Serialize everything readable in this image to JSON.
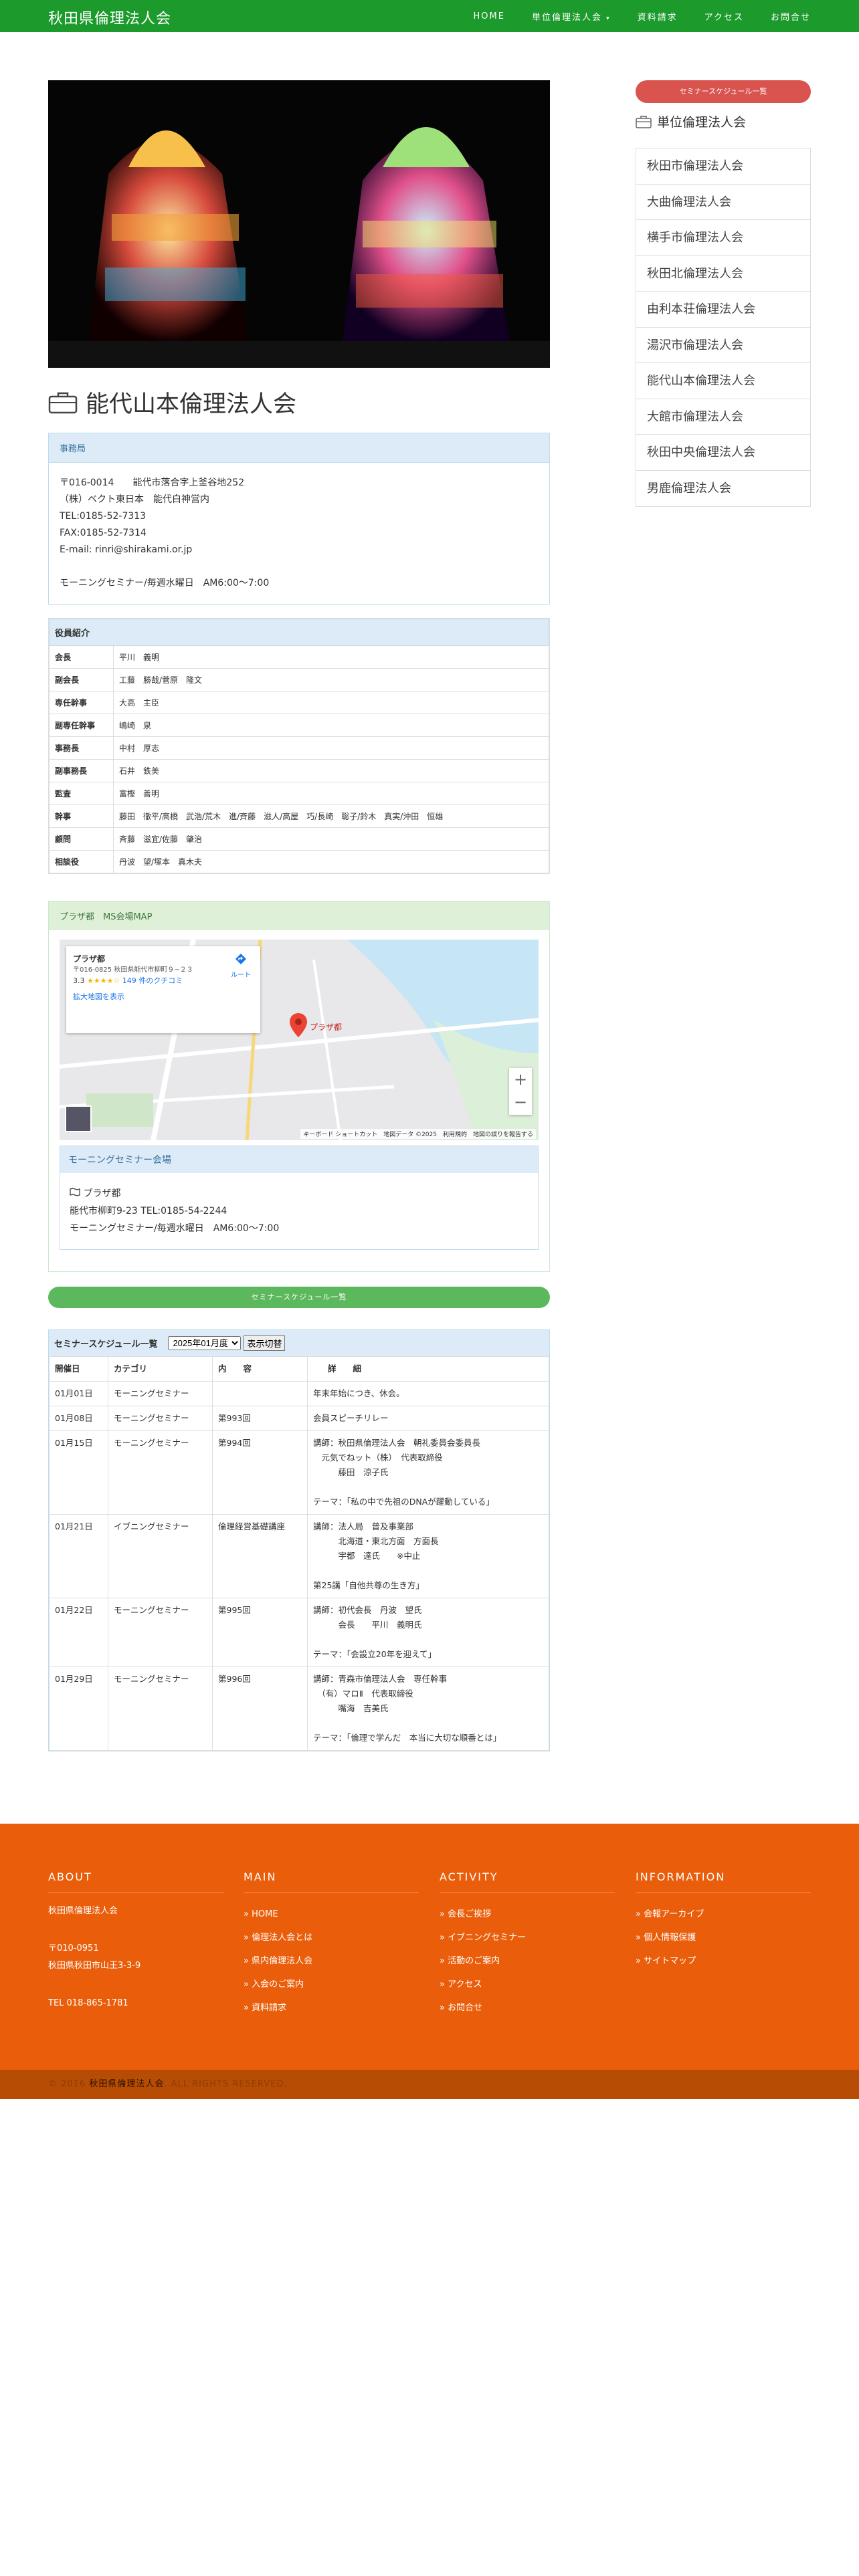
{
  "header": {
    "brand": "秋田県倫理法人会",
    "nav": [
      "HOME",
      "単位倫理法人会 ",
      "資料請求",
      "アクセス",
      "お問合せ"
    ]
  },
  "page_title": "能代山本倫理法人会",
  "office": {
    "heading": "事務局",
    "lines": [
      "〒016-0014　　能代市落合字上釜谷地252",
      "（株）ベクト東日本　能代白神営内",
      "TEL:0185-52-7313",
      "FAX:0185-52-7314",
      "E-mail: rinri@shirakami.or.jp",
      "",
      "モーニングセミナー/毎週水曜日　AM6:00〜7:00"
    ]
  },
  "officers": {
    "heading": "役員紹介",
    "rows": [
      {
        "k": "会長",
        "v": "平川　義明"
      },
      {
        "k": "副会長",
        "v": "工藤　勝哉/菅原　隆文"
      },
      {
        "k": "専任幹事",
        "v": "大高　主臣"
      },
      {
        "k": "副専任幹事",
        "v": "嶋崎　泉"
      },
      {
        "k": "事務長",
        "v": "中村　厚志"
      },
      {
        "k": "副事務長",
        "v": "石井　鉄美"
      },
      {
        "k": "監査",
        "v": "富樫　善明"
      },
      {
        "k": "幹事",
        "v": "藤田　徹平/高橋　武浩/荒木　進/斉藤　滋人/高屋　巧/長崎　聡子/鈴木　真実/沖田　恒雄"
      },
      {
        "k": "顧問",
        "v": "斉藤　滋宜/佐藤　肇治"
      },
      {
        "k": "相談役",
        "v": "丹波　望/塚本　真木夫"
      }
    ]
  },
  "map_panel": {
    "heading": "プラザ都　MS会場MAP",
    "place": "プラザ都",
    "address": "〒016-0825 秋田県能代市柳町９−２３",
    "rating": "3.3",
    "stars": "★★★★☆",
    "reviews": "149 件のクチコミ",
    "route": "ルート",
    "enlarge": "拡大地図を表示",
    "footer_text": "キーボード ショートカット　地図データ ©2025　利用規約　地図の誤りを報告する"
  },
  "venue": {
    "heading": "モーニングセミナー会場",
    "name": "プラザ都",
    "address": "能代市柳町9-23 TEL:0185-54-2244",
    "schedule": "モーニングセミナー/毎週水曜日　AM6:00〜7:00"
  },
  "seminar_button": "セミナースケジュール一覧",
  "schedule": {
    "heading": "セミナースケジュール一覧",
    "select": "2025年01月度",
    "button": "表示切替",
    "columns": [
      "開催日",
      "カテゴリ",
      "内　　容",
      "詳　　細"
    ],
    "rows": [
      {
        "date": "01月01日",
        "cat": "モーニングセミナー",
        "content": "",
        "detail": [
          "年末年始につき、休会。"
        ]
      },
      {
        "date": "01月08日",
        "cat": "モーニングセミナー",
        "content": "第993回",
        "detail": [
          "会員スピーチリレー"
        ]
      },
      {
        "date": "01月15日",
        "cat": "モーニングセミナー",
        "content": "第994回",
        "detail": [
          "講師：秋田県倫理法人会　朝礼委員会委員長",
          "　元気でねット（株）　代表取締役",
          "　　　藤田　涼子氏",
          "",
          "テーマ：「私の中で先祖のDNAが躍動している」"
        ]
      },
      {
        "date": "01月21日",
        "cat": "イブニングセミナー",
        "content": "倫理経営基礎講座",
        "detail": [
          "講師：法人局　普及事業部",
          "　　　北海道・東北方面　方面長",
          "　　　宇都　達氏　　※中止",
          "",
          "第25講「自他共尊の生き方」"
        ]
      },
      {
        "date": "01月22日",
        "cat": "モーニングセミナー",
        "content": "第995回",
        "detail": [
          "講師：初代会長　丹波　望氏",
          "　　　会長　　平川　義明氏",
          "",
          "テーマ：「会設立20年を迎えて」"
        ]
      },
      {
        "date": "01月29日",
        "cat": "モーニングセミナー",
        "content": "第996回",
        "detail": [
          "講師：青森市倫理法人会　専任幹事",
          "　（有）マロⅡ　代表取締役",
          "　　　嘴海　吉美氏",
          "",
          "テーマ：「倫理で学んだ　本当に大切な順番とは」"
        ]
      }
    ]
  },
  "sidebar": {
    "button": "セミナースケジュール一覧",
    "title": "単位倫理法人会",
    "items": [
      "秋田市倫理法人会",
      "大曲倫理法人会",
      "横手市倫理法人会",
      "秋田北倫理法人会",
      "由利本荘倫理法人会",
      "湯沢市倫理法人会",
      "能代山本倫理法人会",
      "大館市倫理法人会",
      "秋田中央倫理法人会",
      "男鹿倫理法人会"
    ]
  },
  "footer": {
    "about": {
      "title": "ABOUT",
      "org": "秋田県倫理法人会",
      "zip": "〒010-0951",
      "addr": "秋田県秋田市山王3-3-9",
      "tel": "TEL 018-865-1781"
    },
    "main": {
      "title": "MAIN",
      "items": [
        "HOME",
        "倫理法人会とは",
        "県内倫理法人会",
        "入会のご案内",
        "資料請求"
      ]
    },
    "activity": {
      "title": "ACTIVITY",
      "items": [
        "会長ご挨拶",
        "イブニングセミナー",
        "活動のご案内",
        "アクセス",
        "お問合せ"
      ]
    },
    "information": {
      "title": "INFORMATION",
      "items": [
        "会報アーカイブ",
        "個人情報保護",
        "サイトマップ"
      ]
    },
    "copy_pre": "© 2016 ",
    "copy_org": "秋田県倫理法人会",
    "copy_post": ". ALL RIGHTS RESERVED."
  },
  "colors": {
    "nav": "#1c9a2c",
    "footer": "#ea5e0b",
    "red": "#d9534f",
    "green": "#5cb85c"
  }
}
